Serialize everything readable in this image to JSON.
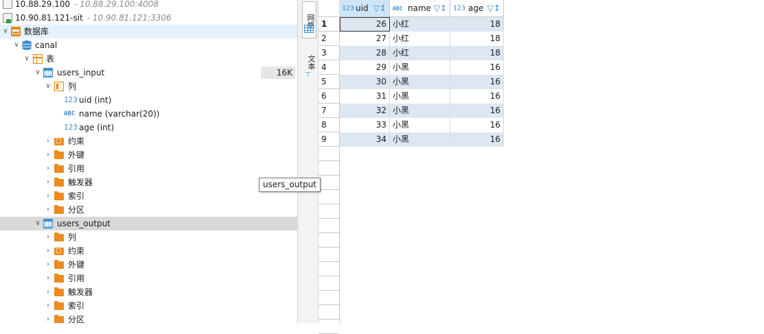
{
  "tree": {
    "connections": [
      {
        "name": "10.88.29.100",
        "detail": "- 10.88.29.100:4008"
      },
      {
        "name": "10.90.81.121-sit",
        "detail": "- 10.90.81.121:3306"
      }
    ],
    "databases_label": "数据库",
    "schema": "canal",
    "tables_label": "表",
    "table1": {
      "name": "users_input",
      "size": "16K",
      "columns_label": "列",
      "columns": [
        {
          "type_icon": "123",
          "label": "uid (int)"
        },
        {
          "type_icon": "ABC",
          "label": "name (varchar(20))"
        },
        {
          "type_icon": "123",
          "label": "age (int)"
        }
      ],
      "folders": [
        "约束",
        "外键",
        "引用",
        "触发器",
        "索引",
        "分区"
      ]
    },
    "table2": {
      "name": "users_output",
      "folders": [
        "列",
        "约束",
        "外键",
        "引用",
        "触发器",
        "索引",
        "分区"
      ]
    }
  },
  "tooltip": "users_output",
  "side_tabs": {
    "grid": "网格",
    "text": "文本"
  },
  "grid": {
    "columns": [
      {
        "type_icon": "123",
        "name": "uid"
      },
      {
        "type_icon": "ABC",
        "name": "name"
      },
      {
        "type_icon": "123",
        "name": "age"
      }
    ],
    "rows": [
      {
        "n": "1",
        "uid": "26",
        "name": "小红",
        "age": "18"
      },
      {
        "n": "2",
        "uid": "27",
        "name": "小红",
        "age": "18"
      },
      {
        "n": "3",
        "uid": "28",
        "name": "小红",
        "age": "18"
      },
      {
        "n": "4",
        "uid": "29",
        "name": "小黑",
        "age": "16"
      },
      {
        "n": "5",
        "uid": "30",
        "name": "小黑",
        "age": "16"
      },
      {
        "n": "6",
        "uid": "31",
        "name": "小黑",
        "age": "16"
      },
      {
        "n": "7",
        "uid": "32",
        "name": "小黑",
        "age": "16"
      },
      {
        "n": "8",
        "uid": "33",
        "name": "小黑",
        "age": "16"
      },
      {
        "n": "9",
        "uid": "34",
        "name": "小黑",
        "age": "16"
      }
    ]
  },
  "colors": {
    "accent": "#3a8fd6",
    "folder": "#ef8a1c",
    "stripe": "#dce7f2",
    "selection": "#e5f1fb"
  }
}
